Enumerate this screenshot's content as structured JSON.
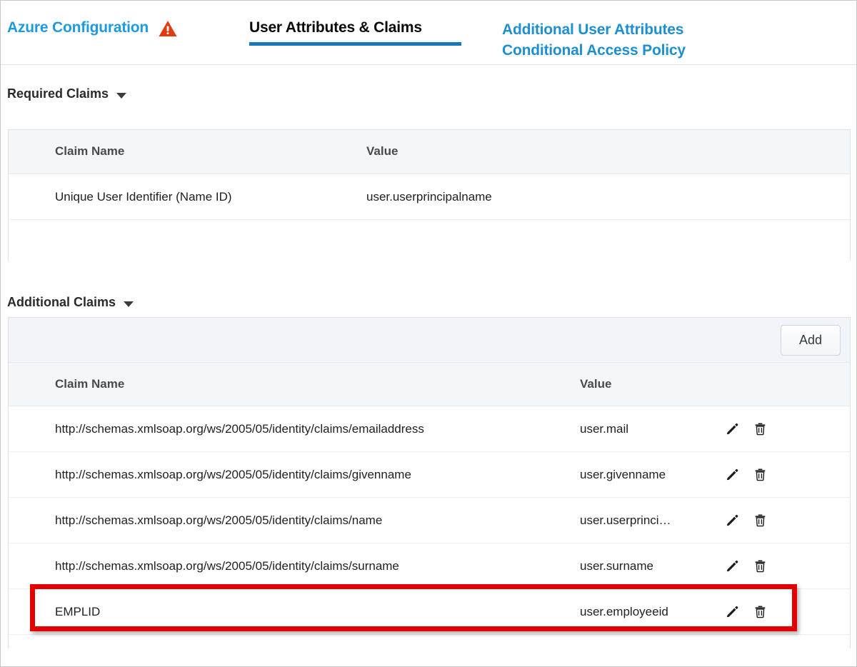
{
  "tabs": [
    {
      "label": "Azure Configuration",
      "state": "inactive",
      "icon": "warning-triangle-icon"
    },
    {
      "label": "User Attributes & Claims",
      "state": "active"
    },
    {
      "label": "Additional User Attributes",
      "state": "inactive"
    },
    {
      "label": "Conditional Access Policy",
      "state": "inactive"
    }
  ],
  "colors": {
    "link_blue": "#1e9ae0",
    "active_underline": "#1976bc",
    "warning_orange": "#e03c0f",
    "highlight_red": "#e20000",
    "table_header_bg": "#f4f7fa"
  },
  "required_claims": {
    "title": "Required Claims",
    "caret": "chevron-down-icon",
    "columns": [
      "Claim Name",
      "Value"
    ],
    "rows": [
      {
        "name": "Unique User Identifier (Name ID)",
        "value": "user.userprincipalname"
      }
    ]
  },
  "additional_claims": {
    "title": "Additional Claims",
    "caret": "chevron-down-icon",
    "add_label": "Add",
    "columns": [
      "Claim Name",
      "Value"
    ],
    "rows": [
      {
        "name": "http://schemas.xmlsoap.org/ws/2005/05/identity/claims/emailaddress",
        "value": "user.mail",
        "edit": "pencil-icon",
        "delete": "trash-icon",
        "highlighted": false
      },
      {
        "name": "http://schemas.xmlsoap.org/ws/2005/05/identity/claims/givenname",
        "value": "user.givenname",
        "edit": "pencil-icon",
        "delete": "trash-icon",
        "highlighted": false
      },
      {
        "name": "http://schemas.xmlsoap.org/ws/2005/05/identity/claims/name",
        "value": "user.userprinci…",
        "edit": "pencil-icon",
        "delete": "trash-icon",
        "highlighted": false
      },
      {
        "name": "http://schemas.xmlsoap.org/ws/2005/05/identity/claims/surname",
        "value": "user.surname",
        "edit": "pencil-icon",
        "delete": "trash-icon",
        "highlighted": false
      },
      {
        "name": "EMPLID",
        "value": "user.employeeid",
        "edit": "pencil-icon",
        "delete": "trash-icon",
        "highlighted": true
      }
    ]
  }
}
